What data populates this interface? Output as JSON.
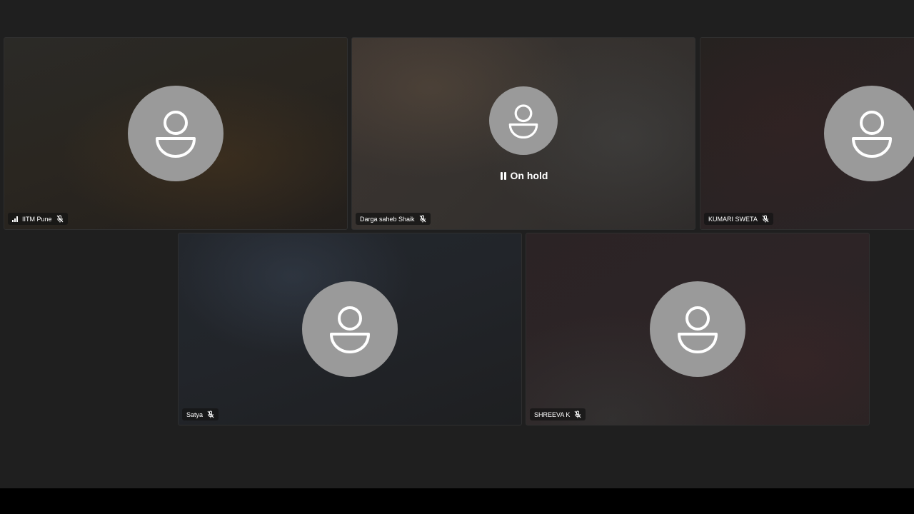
{
  "participants": [
    {
      "name": "IITM Pune",
      "muted": true,
      "signal": true,
      "status": ""
    },
    {
      "name": "Darga saheb Shaik",
      "muted": true,
      "signal": false,
      "status": "On hold"
    },
    {
      "name": "KUMARI SWETA",
      "muted": true,
      "signal": false,
      "status": ""
    },
    {
      "name": "Satya",
      "muted": true,
      "signal": false,
      "status": ""
    },
    {
      "name": "SHREEVA K",
      "muted": true,
      "signal": false,
      "status": ""
    }
  ],
  "icons": {
    "avatar": "person-icon",
    "mic": "mic-off-icon",
    "signal": "signal-icon",
    "hold": "pause-icon"
  },
  "colors": {
    "background": "#1f1f1f",
    "avatar": "#9a9a9a",
    "bottom_bar": "#000000"
  }
}
